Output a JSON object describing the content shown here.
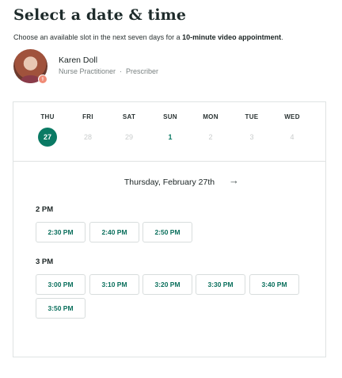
{
  "header": {
    "title": "Select a date & time",
    "subtitle_prefix": "Choose an available slot in the next seven days for a ",
    "subtitle_emphasis": "10-minute video appointment",
    "subtitle_suffix": "."
  },
  "provider": {
    "name": "Karen Doll",
    "role": "Nurse Practitioner",
    "separator": "·",
    "secondary_role": "Prescriber",
    "avatar_icon": "provider-photo",
    "badge_icon": "prescriber-badge-icon"
  },
  "days": [
    {
      "label": "THU",
      "number": "27",
      "state": "selected"
    },
    {
      "label": "FRI",
      "number": "28",
      "state": "disabled"
    },
    {
      "label": "SAT",
      "number": "29",
      "state": "disabled"
    },
    {
      "label": "SUN",
      "number": "1",
      "state": "available"
    },
    {
      "label": "MON",
      "number": "2",
      "state": "disabled"
    },
    {
      "label": "TUE",
      "number": "3",
      "state": "disabled"
    },
    {
      "label": "WED",
      "number": "4",
      "state": "disabled"
    }
  ],
  "selected_date": "Thursday, February 27th",
  "next_icon": "arrow-right-icon",
  "hours": [
    {
      "label": "2 PM",
      "slots": [
        "2:30 PM",
        "2:40 PM",
        "2:50 PM"
      ]
    },
    {
      "label": "3 PM",
      "slots": [
        "3:00 PM",
        "3:10 PM",
        "3:20 PM",
        "3:30 PM",
        "3:40 PM",
        "3:50 PM"
      ]
    }
  ],
  "colors": {
    "accent": "#0a7a64",
    "border": "#dfe3e3",
    "text": "#1b2424",
    "muted": "#7a8282",
    "disabled": "#c9cccc"
  }
}
